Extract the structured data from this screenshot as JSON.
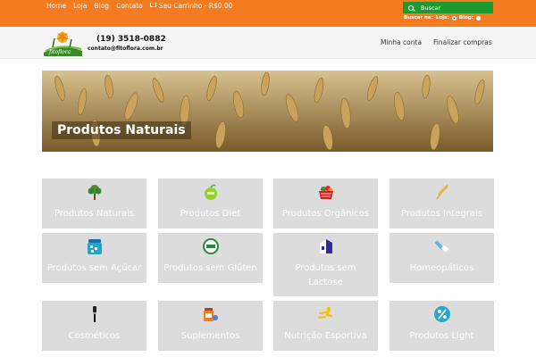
{
  "topbar": {
    "nav": [
      "Home",
      "Loja",
      "Blog",
      "Contato"
    ],
    "cart_label": "Seu Carrinho - R$0.00",
    "search_placeholder": "Buscar",
    "search_scope_label": "Buscar na:",
    "scope_options": [
      "Loja:",
      "Blog:"
    ]
  },
  "header": {
    "phone": "(19) 3518-0882",
    "email": "contato@fitoflora.com.br",
    "menu": [
      "Minha conta",
      "Finalizar compras"
    ]
  },
  "banner": {
    "title": "Produtos Naturais"
  },
  "categories": [
    {
      "label": "Produtos Naturais",
      "icon": "tree-icon"
    },
    {
      "label": "Produtos Diet",
      "icon": "apple-icon"
    },
    {
      "label": "Produtos Orgânicos",
      "icon": "basket-icon"
    },
    {
      "label": "Produtos Integrais",
      "icon": "wheat-icon"
    },
    {
      "label": "Produtos sem Açúcar",
      "icon": "sugar-jar-icon"
    },
    {
      "label": "Produtos sem Glúten",
      "icon": "gluten-free-icon"
    },
    {
      "label": "Produtos sem Lactose",
      "icon": "milk-carton-icon"
    },
    {
      "label": "Homeopáticos",
      "icon": "dropper-icon"
    },
    {
      "label": "Cosméticos",
      "icon": "brush-icon"
    },
    {
      "label": "Suplementos",
      "icon": "pill-bottle-icon"
    },
    {
      "label": "Nutrição Esportiva",
      "icon": "runner-icon"
    },
    {
      "label": "Produtos Light",
      "icon": "percent-icon"
    }
  ],
  "colors": {
    "topbar": "#f47b20",
    "search": "#1e9a2f",
    "tile": "#dcdcdc"
  }
}
